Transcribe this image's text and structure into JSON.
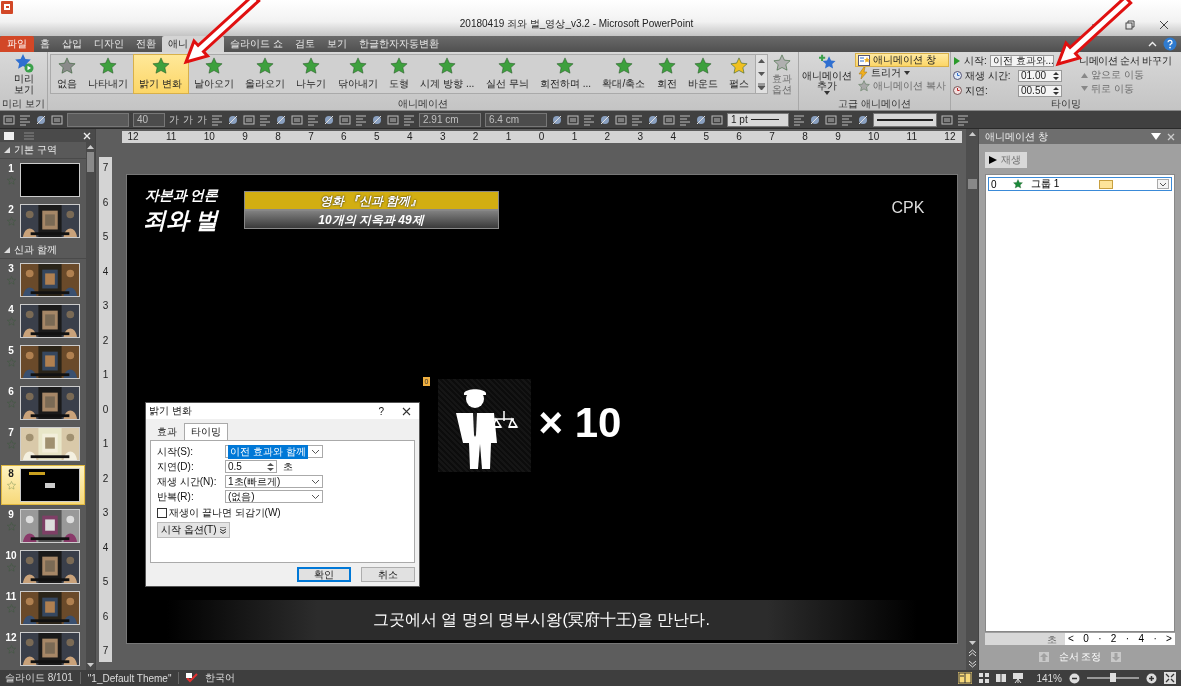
{
  "window": {
    "title": "20180419 죄와 벌_영상_v3.2 - Microsoft PowerPoint"
  },
  "ribbon_tabs": [
    {
      "label": "파일",
      "kind": "file",
      "selected": false
    },
    {
      "label": "홈",
      "kind": "tab",
      "selected": false
    },
    {
      "label": "삽입",
      "kind": "tab",
      "selected": false
    },
    {
      "label": "디자인",
      "kind": "tab",
      "selected": false
    },
    {
      "label": "전환",
      "kind": "tab",
      "selected": false
    },
    {
      "label": "애니",
      "kind": "tab",
      "selected": true
    },
    {
      "label": "슬라이드 쇼",
      "kind": "tab",
      "selected": false
    },
    {
      "label": "검토",
      "kind": "tab",
      "selected": false
    },
    {
      "label": "보기",
      "kind": "tab",
      "selected": false
    },
    {
      "label": "한글한자자동변환",
      "kind": "tab",
      "selected": false
    }
  ],
  "preview": {
    "button": "미리 보기",
    "group": "미리 보기"
  },
  "animations": {
    "items": [
      {
        "label": "없음",
        "selected": false
      },
      {
        "label": "나타내기",
        "selected": false
      },
      {
        "label": "밝기 변화",
        "selected": true
      },
      {
        "label": "날아오기",
        "selected": false
      },
      {
        "label": "올라오기",
        "selected": false
      },
      {
        "label": "나누기",
        "selected": false
      },
      {
        "label": "닦아내기",
        "selected": false
      },
      {
        "label": "도형",
        "selected": false
      },
      {
        "label": "시계 방향 ...",
        "selected": false
      },
      {
        "label": "실선 무늬",
        "selected": false
      },
      {
        "label": "회전하며 ...",
        "selected": false
      },
      {
        "label": "확대/축소",
        "selected": false
      },
      {
        "label": "회전",
        "selected": false
      },
      {
        "label": "바운드",
        "selected": false
      },
      {
        "label": "펄스",
        "selected": false
      }
    ],
    "options": {
      "label": "효과 옵션",
      "disabled": true
    },
    "group": "애니메이션"
  },
  "advanced": {
    "add_button": "애니메이션 추가",
    "pane_button": {
      "label": "애니메이션 창",
      "selected": true
    },
    "trigger": "트리거",
    "copy": {
      "label": "애니메이션 복사",
      "disabled": true
    },
    "group": "고급 애니메이션"
  },
  "timing": {
    "start_label": "시작:",
    "start_value": "이전 효과와...",
    "duration_label": "재생 시간:",
    "duration": "01.00",
    "delay_label": "지연:",
    "delay": "00.50",
    "reorder_title": "니메이션 순서 바꾸기",
    "move_earlier": {
      "label": "앞으로 이동",
      "disabled": true
    },
    "move_later": {
      "label": "뒤로 이동",
      "disabled": true
    },
    "group": "타이밍"
  },
  "toolbar": {
    "font_glyphs": [
      "가",
      "가",
      "가"
    ],
    "font_size": "40",
    "position_x": "2.91 cm",
    "position_y": "6.4 cm",
    "line_weight": "1 pt"
  },
  "slides_panel": {
    "sections": [
      {
        "title": "기본 구역",
        "expanded": true,
        "slides": [
          {
            "number": "1",
            "kind": "blank",
            "selected": false
          },
          {
            "number": "2",
            "kind": "picture",
            "selected": false
          }
        ]
      },
      {
        "title": "신과 함께",
        "expanded": true,
        "slides": [
          {
            "number": "3",
            "kind": "picture",
            "selected": false
          },
          {
            "number": "4",
            "kind": "picture",
            "selected": false
          },
          {
            "number": "5",
            "kind": "picture",
            "selected": false
          },
          {
            "number": "6",
            "kind": "picture",
            "selected": false
          },
          {
            "number": "7",
            "kind": "picture",
            "selected": false
          },
          {
            "number": "8",
            "kind": "blank",
            "selected": true
          },
          {
            "number": "9",
            "kind": "picture",
            "selected": false
          },
          {
            "number": "10",
            "kind": "picture",
            "selected": false
          },
          {
            "number": "11",
            "kind": "picture",
            "selected": false
          },
          {
            "number": "12",
            "kind": "picture",
            "selected": false
          }
        ]
      }
    ]
  },
  "rulers": {
    "horizontal": [
      "12",
      "11",
      "10",
      "9",
      "8",
      "7",
      "6",
      "5",
      "4",
      "3",
      "2",
      "1",
      "0",
      "1",
      "2",
      "3",
      "4",
      "5",
      "6",
      "7",
      "8",
      "9",
      "10",
      "11",
      "12"
    ],
    "vertical": [
      "7",
      "6",
      "5",
      "4",
      "3",
      "2",
      "1",
      "0",
      "1",
      "2",
      "3",
      "4",
      "5",
      "6",
      "7"
    ]
  },
  "slide": {
    "subtitle": "자본과 언론",
    "title": "죄와 벌",
    "banner_top": "영화 『신과 함께』",
    "banner_bottom": "10개의 지옥과 49제",
    "logo": "CPK",
    "anim_tag": "0",
    "multiplier": "× 10",
    "caption": "그곳에서 열 명의 명부시왕(冥府十王)을 만난다."
  },
  "dialog": {
    "title": "밝기 변화",
    "help": "?",
    "tabs": [
      {
        "label": "효과",
        "selected": false
      },
      {
        "label": "타이밍",
        "selected": true
      }
    ],
    "fields": [
      {
        "kind": "dropdown",
        "label": "시작(S):",
        "value": "이전 효과와 함께",
        "focused": true
      },
      {
        "kind": "spinner",
        "label": "지연(D):",
        "value": "0.5",
        "unit": "초",
        "focused": false
      },
      {
        "kind": "dropdown",
        "label": "재생 시간(N):",
        "value": "1초(빠르게)",
        "focused": false
      },
      {
        "kind": "dropdown",
        "label": "반복(R):",
        "value": "(없음)",
        "focused": false
      }
    ],
    "rewind": {
      "label": "재생이 끝나면 되감기(W)",
      "checked": false
    },
    "triggers_button": "시작 옵션(T)",
    "buttons": [
      {
        "label": "확인",
        "default": true
      },
      {
        "label": "취소",
        "default": false
      }
    ]
  },
  "anim_pane": {
    "title": "애니메이션 창",
    "play_button": {
      "label": "재생",
      "disabled": true
    },
    "items": [
      {
        "index": "0",
        "label": "그룹 1",
        "selected": true
      }
    ],
    "timeline": {
      "unit": "초",
      "ticks": [
        "<",
        "0",
        "·",
        "2",
        "·",
        "4",
        "·",
        ">"
      ]
    },
    "reorder": "순서 조정"
  },
  "status": {
    "slide": "슬라이드 8/101",
    "theme": "\"1_Default Theme\"",
    "language": "한국어",
    "zoom": "141%",
    "zoom_slider": {
      "level": 0.5
    }
  }
}
